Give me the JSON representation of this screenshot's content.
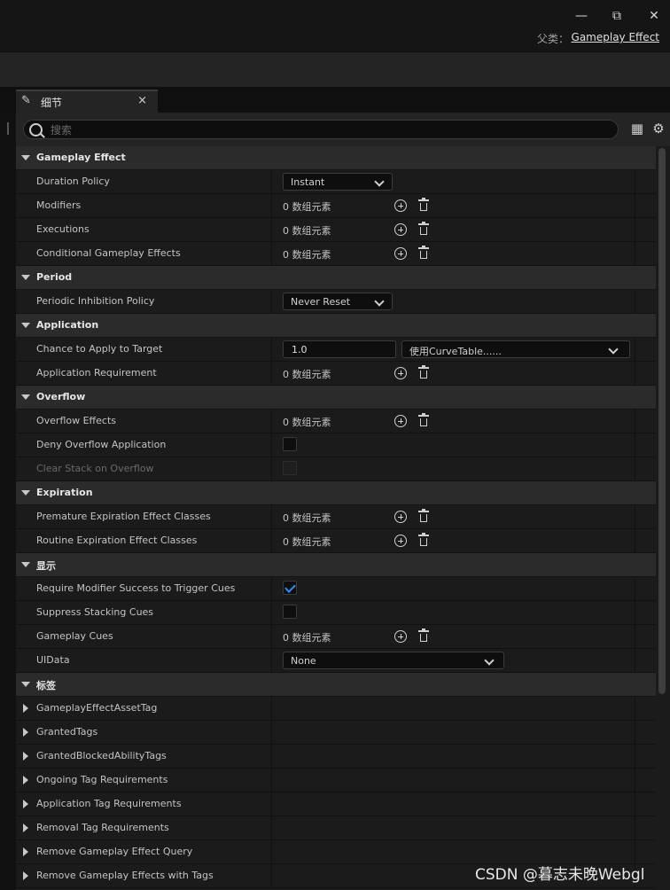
{
  "window": {
    "minimize": "—",
    "restore": "⧉",
    "close": "✕",
    "parent_label": "父类：",
    "parent_link": "Gameplay Effect"
  },
  "tab": {
    "title": "细节",
    "close": "×"
  },
  "search": {
    "placeholder": "搜索"
  },
  "icons": {
    "table_view": "▦",
    "settings": "⚙"
  },
  "empty_array": "0 数组元素",
  "sections": [
    {
      "title": "Gameplay Effect",
      "rows": [
        {
          "name": "Duration Policy",
          "combo": "Instant"
        },
        {
          "name": "Modifiers",
          "array": true
        },
        {
          "name": "Executions",
          "array": true
        },
        {
          "name": "Conditional Gameplay Effects",
          "array": true
        }
      ]
    },
    {
      "title": "Period",
      "rows": [
        {
          "name": "Periodic Inhibition Policy",
          "combo": "Never Reset"
        }
      ]
    },
    {
      "title": "Application",
      "rows": [
        {
          "name": "Chance to Apply to Target",
          "number": "1.0",
          "curve": "使用CurveTable......"
        },
        {
          "name": "Application Requirement",
          "array": true
        }
      ]
    },
    {
      "title": "Overflow",
      "rows": [
        {
          "name": "Overflow Effects",
          "array": true
        },
        {
          "name": "Deny Overflow Application",
          "checkbox": false
        },
        {
          "name": "Clear Stack on Overflow",
          "checkbox": false,
          "disabled": true
        }
      ]
    },
    {
      "title": "Expiration",
      "rows": [
        {
          "name": "Premature Expiration Effect Classes",
          "array": true
        },
        {
          "name": "Routine Expiration Effect Classes",
          "array": true
        }
      ]
    },
    {
      "title": "显示",
      "rows": [
        {
          "name": "Require Modifier Success to Trigger Cues",
          "checkbox": true
        },
        {
          "name": "Suppress Stacking Cues",
          "checkbox": false
        },
        {
          "name": "Gameplay Cues",
          "array": true
        },
        {
          "name": "UIData",
          "wide_combo": "None"
        }
      ]
    },
    {
      "title": "标签",
      "rows": [
        {
          "name": "GameplayEffectAssetTag",
          "collapsed": true
        },
        {
          "name": "GrantedTags",
          "collapsed": true
        },
        {
          "name": "GrantedBlockedAbilityTags",
          "collapsed": true
        },
        {
          "name": "Ongoing Tag Requirements",
          "collapsed": true
        },
        {
          "name": "Application Tag Requirements",
          "collapsed": true
        },
        {
          "name": "Removal Tag Requirements",
          "collapsed": true
        },
        {
          "name": "Remove Gameplay Effect Query",
          "collapsed": true
        },
        {
          "name": "Remove Gameplay Effects with Tags",
          "collapsed": true
        }
      ]
    }
  ],
  "watermark": "CSDN @暮志未晚Webgl"
}
